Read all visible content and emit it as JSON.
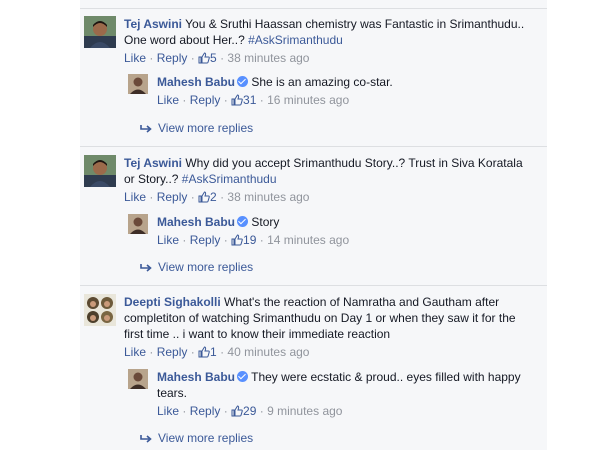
{
  "threads": [
    {
      "author": "Tej Aswini",
      "text": " You & Sruthi Haassan chemistry was Fantastic in Srimanthudu.. One word about Her..? ",
      "hashtag": "#AskSrimanthudu",
      "like": "Like",
      "reply": "Reply",
      "likes": "5",
      "time": "38 minutes ago",
      "response": {
        "author": "Mahesh Babu",
        "text": " She is an amazing co-star.",
        "like": "Like",
        "reply": "Reply",
        "likes": "31",
        "time": "16 minutes ago"
      },
      "more": "View more replies"
    },
    {
      "author": "Tej Aswini",
      "text": " Why did you accept Srimanthudu Story..? Trust in Siva Koratala or Story..? ",
      "hashtag": "#AskSrimanthudu",
      "like": "Like",
      "reply": "Reply",
      "likes": "2",
      "time": "38 minutes ago",
      "response": {
        "author": "Mahesh Babu",
        "text": " Story",
        "like": "Like",
        "reply": "Reply",
        "likes": "19",
        "time": "14 minutes ago"
      },
      "more": "View more replies"
    },
    {
      "author": "Deepti Sighakolli",
      "text": " What's the reaction of Namratha and Gautham after completiton of watching Srimanthudu on Day 1 or when they saw it for the first time .. i want to know their immediate reaction",
      "hashtag": "",
      "like": "Like",
      "reply": "Reply",
      "likes": "1",
      "time": "40 minutes ago",
      "response": {
        "author": "Mahesh Babu",
        "text": " They were ecstatic & proud.. eyes filled with happy tears.",
        "like": "Like",
        "reply": "Reply",
        "likes": "29",
        "time": "9 minutes ago"
      },
      "more": "View more replies"
    }
  ]
}
